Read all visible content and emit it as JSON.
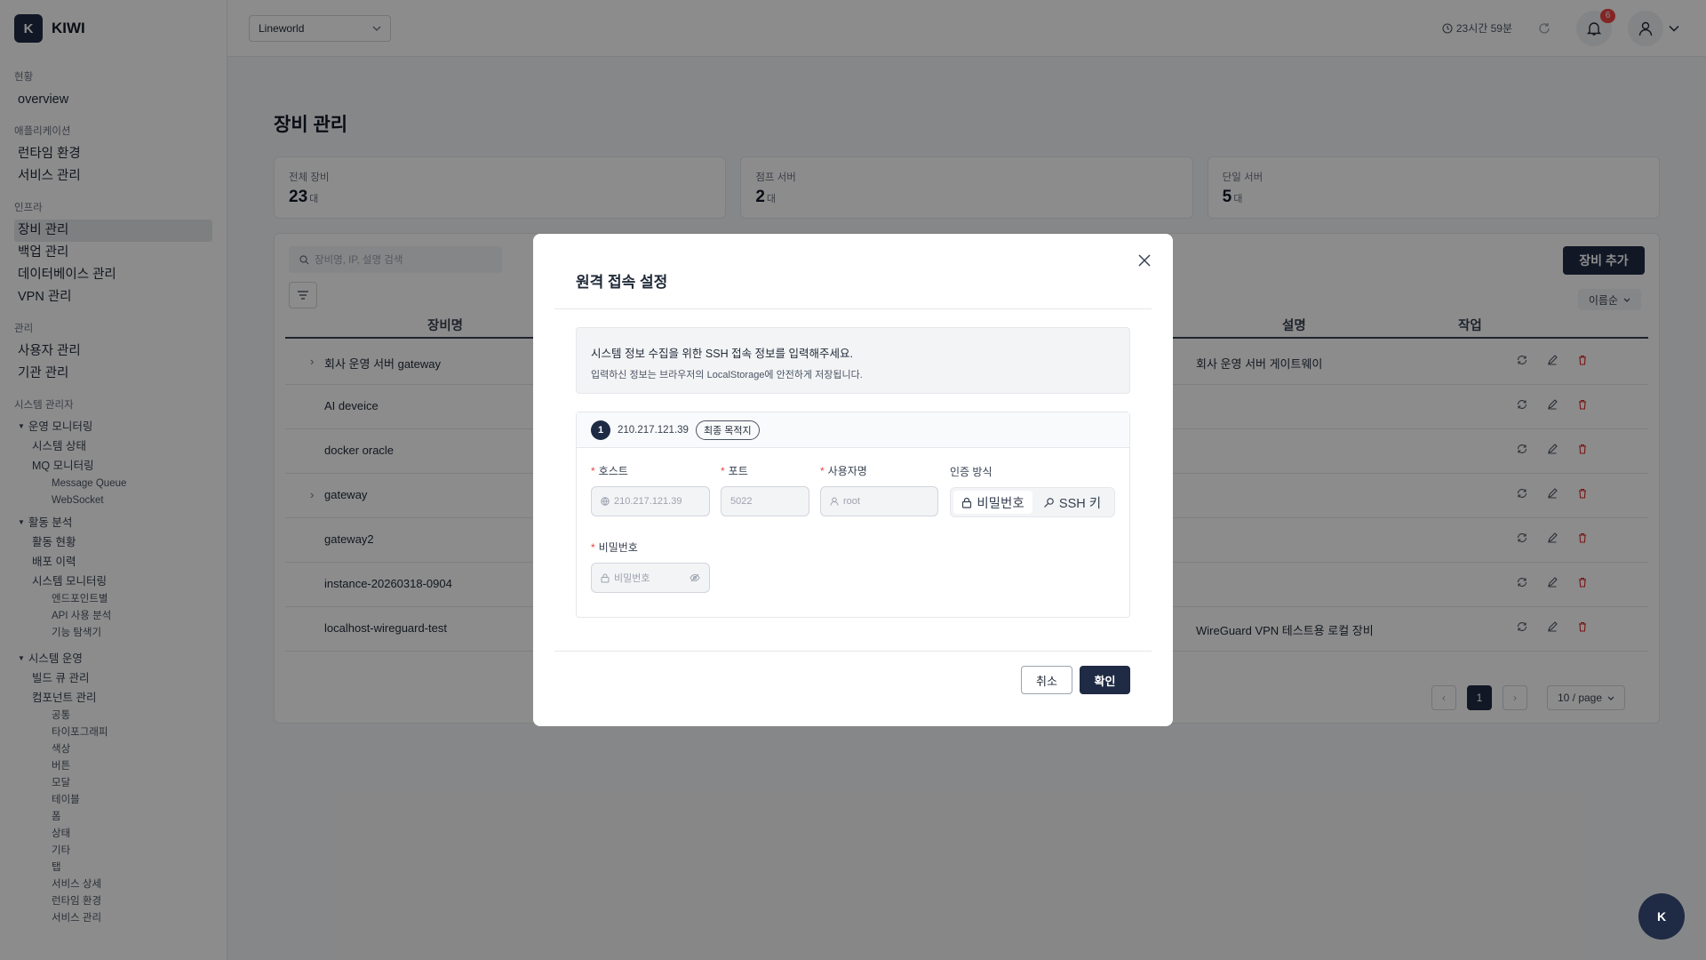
{
  "brand": {
    "logo_letter": "K",
    "name": "KIWI"
  },
  "topbar": {
    "workspace": "Lineworld",
    "session": "23시간 59분",
    "notifications": "6"
  },
  "sidebar": {
    "sections": [
      {
        "title": "현황",
        "items": [
          "overview"
        ]
      },
      {
        "title": "애플리케이션",
        "items": [
          "런타임 환경",
          "서비스 관리"
        ]
      },
      {
        "title": "인프라",
        "items": [
          "장비 관리",
          "백업 관리",
          "데이터베이스 관리",
          "VPN 관리"
        ]
      },
      {
        "title": "관리",
        "items": [
          "사용자 관리",
          "기관 관리"
        ]
      }
    ],
    "sysadmin": {
      "title": "시스템 관리자",
      "monitoring": {
        "title": "운영 모니터링",
        "items": [
          "시스템 상태",
          "MQ 모니터링"
        ],
        "mq_items": [
          "Message Queue",
          "WebSocket"
        ]
      },
      "activity": {
        "title": "활동 분석",
        "items": [
          "활동 현황",
          "배포 이력",
          "시스템 모니터링"
        ],
        "sub_items": [
          "엔드포인트별",
          "API 사용 분석",
          "기능 탐색기"
        ]
      },
      "ops": {
        "title": "시스템 운영",
        "items": [
          "빌드 큐 관리",
          "컴포넌트 관리"
        ],
        "sub_items": [
          "공통",
          "타이포그래피",
          "색상",
          "버튼",
          "모달",
          "테이블",
          "폼",
          "상태",
          "기타",
          "탭",
          "서비스 상세",
          "런타임 환경",
          "서비스 관리"
        ]
      }
    }
  },
  "page": {
    "title": "장비 관리",
    "stats": [
      {
        "label": "전체 장비",
        "value": "23",
        "unit": "대"
      },
      {
        "label": "점프 서버",
        "value": "2",
        "unit": "대"
      },
      {
        "label": "단일 서버",
        "value": "5",
        "unit": "대"
      }
    ],
    "search_placeholder": "장비명, IP, 설명 검색",
    "add_button": "장비 추가",
    "sort_label": "이름순",
    "columns": {
      "name": "장비명",
      "desc": "설명",
      "action": "작업"
    },
    "rows": [
      {
        "name": "회사 운영 서버 gateway",
        "desc": "회사 운영 서버 게이트웨이",
        "expand": "›"
      },
      {
        "name": "AI deveice",
        "desc": "",
        "expand": ""
      },
      {
        "name": "docker oracle",
        "desc": "",
        "expand": ""
      },
      {
        "name": "gateway",
        "desc": "",
        "expand": "›"
      },
      {
        "name": "gateway2",
        "desc": "",
        "expand": ""
      },
      {
        "name": "instance-20260318-0904",
        "desc": "",
        "expand": ""
      },
      {
        "name": "localhost-wireguard-test",
        "desc": "WireGuard VPN 테스트용 로컬 장비",
        "expand": ""
      }
    ],
    "pagination": {
      "current": "1",
      "per_page": "10 / page"
    }
  },
  "modal": {
    "title": "원격 접속 설정",
    "info_line1": "시스템 정보 수집을 위한 SSH 접속 정보를 입력해주세요.",
    "info_line2": "입력하신 정보는 브라우저의 LocalStorage에 안전하게 저장됩니다.",
    "hop": {
      "number": "1",
      "ip": "210.217.121.39",
      "tag": "최종 목적지"
    },
    "fields": {
      "host": {
        "label": "호스트",
        "placeholder": "210.217.121.39"
      },
      "port": {
        "label": "포트",
        "placeholder": "5022"
      },
      "user": {
        "label": "사용자명",
        "placeholder": "root"
      },
      "auth": {
        "label": "인증 방식",
        "options": [
          "비밀번호",
          "SSH 키"
        ]
      },
      "password": {
        "label": "비밀번호",
        "placeholder": "비밀번호"
      }
    },
    "required_mark": "*",
    "cancel": "취소",
    "confirm": "확인"
  },
  "fab": {
    "letter": "K"
  }
}
